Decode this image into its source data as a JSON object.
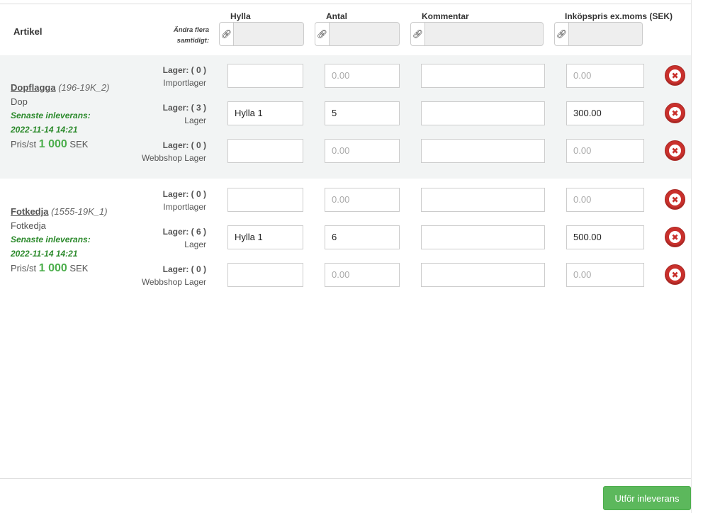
{
  "header": {
    "artikel": "Artikel",
    "multi_edit_line1": "Ändra flera",
    "multi_edit_line2": "samtidigt:",
    "columns": [
      {
        "key": "hylla",
        "label": "Hylla"
      },
      {
        "key": "antal",
        "label": "Antal"
      },
      {
        "key": "kommentar",
        "label": "Kommentar"
      },
      {
        "key": "pris",
        "label": "Inköpspris ex.moms (SEK)"
      }
    ],
    "link_icon": "link-icon"
  },
  "articles": [
    {
      "name": "Dopflagga",
      "code": "(196-19K_2)",
      "subtitle": "Dop",
      "latest_label": "Senaste inleverans:",
      "latest_date": "2022-11-14 14:21",
      "price_prefix": "Pris/st",
      "price_value": "1 000",
      "price_currency": "SEK",
      "rows": [
        {
          "lager_label": "Lager: ( 0 )",
          "lager_name": "Importlager",
          "hylla": "",
          "antal": "0.00",
          "kommentar": "",
          "pris": "0.00"
        },
        {
          "lager_label": "Lager: ( 3 )",
          "lager_name": "Lager",
          "hylla": "Hylla  1",
          "antal": "5",
          "kommentar": "",
          "pris": "300.00"
        },
        {
          "lager_label": "Lager: ( 0 )",
          "lager_name": "Webbshop Lager",
          "hylla": "",
          "antal": "0.00",
          "kommentar": "",
          "pris": "0.00"
        }
      ]
    },
    {
      "name": "Fotkedja",
      "code": "(1555-19K_1)",
      "subtitle": "Fotkedja",
      "latest_label": "Senaste inleverans:",
      "latest_date": "2022-11-14 14:21",
      "price_prefix": "Pris/st",
      "price_value": "1 000",
      "price_currency": "SEK",
      "rows": [
        {
          "lager_label": "Lager: ( 0 )",
          "lager_name": "Importlager",
          "hylla": "",
          "antal": "0.00",
          "kommentar": "",
          "pris": "0.00"
        },
        {
          "lager_label": "Lager: ( 6 )",
          "lager_name": "Lager",
          "hylla": "Hylla  1",
          "antal": "6",
          "kommentar": "",
          "pris": "500.00"
        },
        {
          "lager_label": "Lager: ( 0 )",
          "lager_name": "Webbshop Lager",
          "hylla": "",
          "antal": "0.00",
          "kommentar": "",
          "pris": "0.00"
        }
      ]
    }
  ],
  "actions": {
    "submit_label": "Utför inleverans"
  },
  "colors": {
    "accent_green": "#5cb85c",
    "latest_green": "#2c8a2c",
    "delete_red": "#c9302c",
    "row_shade": "#f2f4f4"
  }
}
